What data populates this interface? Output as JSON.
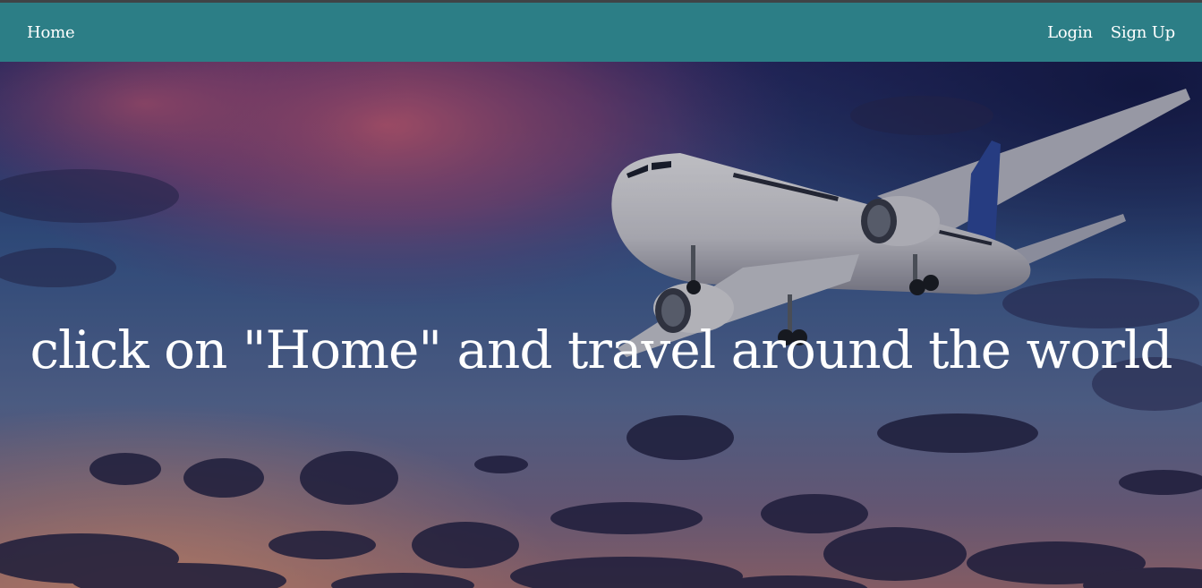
{
  "navbar": {
    "home_label": "Home",
    "login_label": "Login",
    "signup_label": "Sign Up",
    "background_color": "#2c7e86"
  },
  "hero": {
    "headline": "click on \"Home\" and travel around the world",
    "background": "sunset-sky-with-airplane-image"
  }
}
